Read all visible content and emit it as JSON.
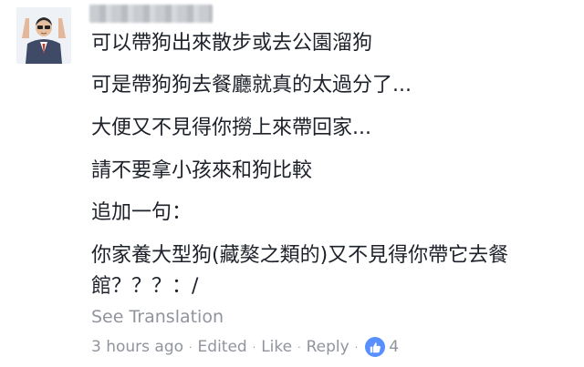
{
  "comment": {
    "lines": [
      "可以帶狗出來散步或去公園溜狗",
      "可是帶狗狗去餐廳就真的太過分了...",
      "大便又不見得你撈上來帶回家...",
      "請不要拿小孩來和狗比較",
      "追加一句：",
      "你家養大型狗(藏獒之類的)又不見得你帶它去餐",
      "館？？？：/"
    ],
    "see_translation": "See Translation",
    "meta": {
      "time": "3 hours ago",
      "edited": "Edited",
      "like": "Like",
      "reply": "Reply",
      "separator": "·",
      "like_count": "4"
    }
  },
  "colors": {
    "text": "#1d2129",
    "meta": "#90949c",
    "like_badge": "#5890ff"
  },
  "icons": {
    "like": "thumbs-up-icon"
  }
}
